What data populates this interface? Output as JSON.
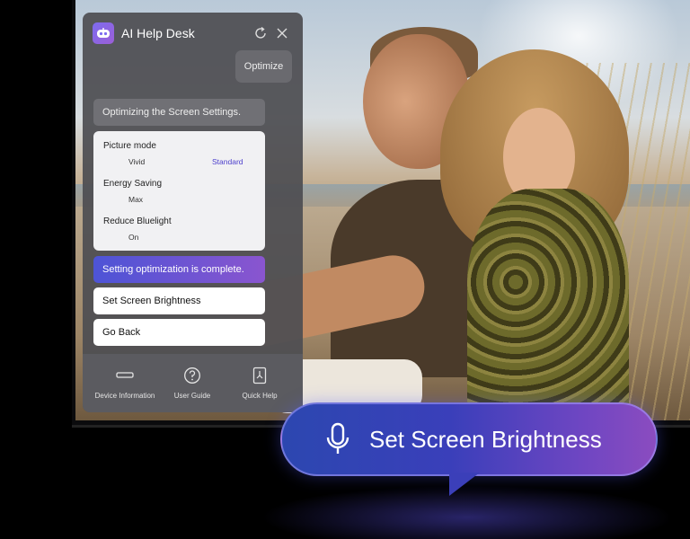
{
  "help_desk": {
    "title": "AI Help Desk",
    "optimize_label": "Optimize",
    "status_message": "Optimizing the Screen Settings.",
    "settings": [
      {
        "name": "Picture mode",
        "value": "Vivid",
        "new_value": "Standard"
      },
      {
        "name": "Energy Saving",
        "value": "Max",
        "new_value": ""
      },
      {
        "name": "Reduce Bluelight",
        "value": "On",
        "new_value": ""
      }
    ],
    "complete_message": "Setting optimization is complete.",
    "actions": {
      "brightness_label": "Set Screen Brightness",
      "back_label": "Go Back"
    },
    "footer": {
      "device_info": "Device Information",
      "user_guide": "User Guide",
      "quick_help": "Quick Help"
    }
  },
  "voice_command": {
    "text": "Set Screen Brightness",
    "icon": "microphone-icon"
  },
  "colors": {
    "accent_purple": "#4b3ecc",
    "bubble_start": "#2c47b0",
    "bubble_end": "#8b4cc0"
  }
}
